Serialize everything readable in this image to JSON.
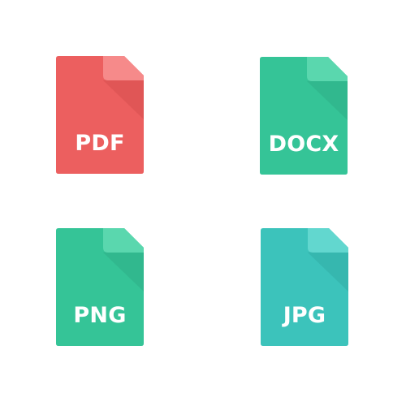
{
  "icons": [
    {
      "id": "pdf",
      "label": "PDF",
      "name": "pdf-file-icon",
      "colors": {
        "body": "#EC5F5F",
        "fold": "#F68A8A",
        "shadow": "#D74F4F"
      }
    },
    {
      "id": "docx",
      "label": "DOCX",
      "name": "docx-file-icon",
      "colors": {
        "body": "#35C497",
        "fold": "#5AD7AE",
        "shadow": "#2DAE86"
      }
    },
    {
      "id": "png",
      "label": "PNG",
      "name": "png-file-icon",
      "colors": {
        "body": "#35C497",
        "fold": "#5AD7AE",
        "shadow": "#2DAE86"
      }
    },
    {
      "id": "jpg",
      "label": "JPG",
      "name": "jpg-file-icon",
      "colors": {
        "body": "#3CC3BB",
        "fold": "#62D7CF",
        "shadow": "#32ADA6"
      }
    }
  ]
}
